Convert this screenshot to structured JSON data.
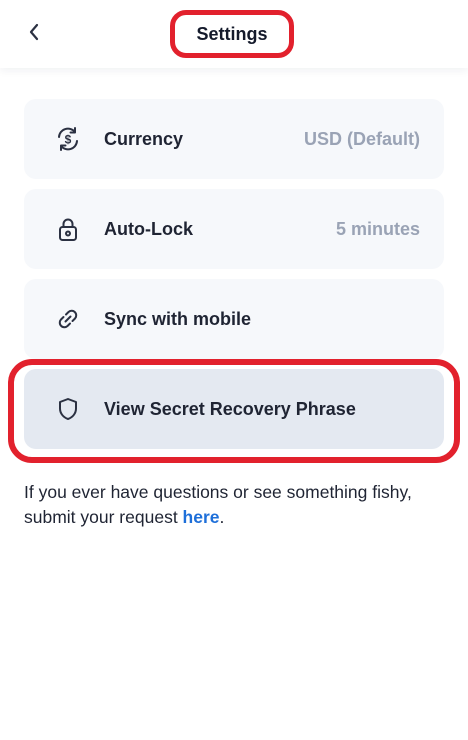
{
  "header": {
    "title": "Settings"
  },
  "settings": {
    "items": [
      {
        "label": "Currency",
        "value": "USD (Default)",
        "icon": "currency-exchange-icon"
      },
      {
        "label": "Auto-Lock",
        "value": "5 minutes",
        "icon": "lock-icon"
      },
      {
        "label": "Sync with mobile",
        "icon": "link-icon"
      },
      {
        "label": "View Secret Recovery Phrase",
        "icon": "shield-icon"
      }
    ]
  },
  "help": {
    "text": "If you ever have questions or see something fishy, submit your request ",
    "link_label": "here",
    "suffix": "."
  },
  "colors": {
    "highlight": "#e2212d",
    "link": "#1e6fd9",
    "row_bg": "#f6f8fb",
    "row_active_bg": "#e4e9f1",
    "value_text": "#9aa3b5"
  }
}
